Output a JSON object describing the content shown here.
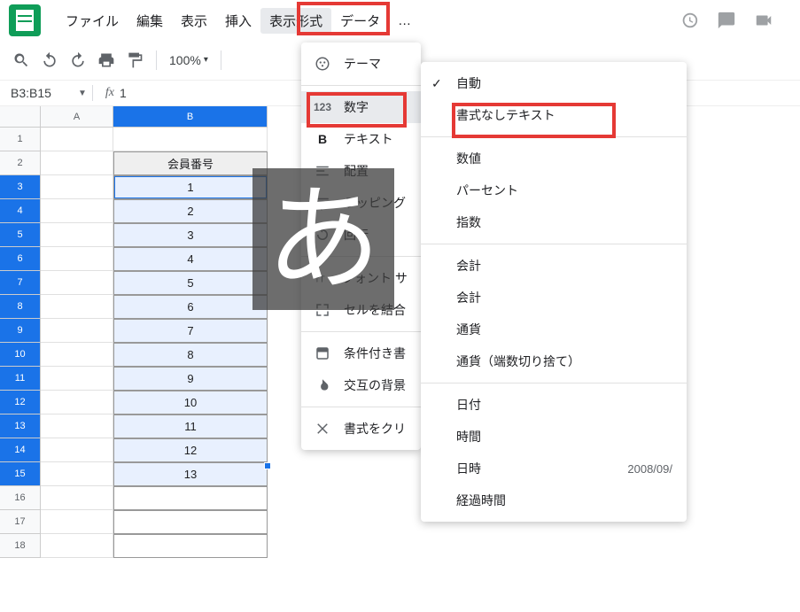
{
  "menu": {
    "file": "ファイル",
    "edit": "編集",
    "view": "表示",
    "insert": "挿入",
    "format": "表示形式",
    "data": "データ",
    "more": "…"
  },
  "toolbar": {
    "zoom": "100%"
  },
  "namebox": {
    "ref": "B3:B15",
    "formula": "1"
  },
  "columns": {
    "A": "A",
    "B": "B"
  },
  "header_b2": "会員番号",
  "rows_b": [
    "1",
    "2",
    "3",
    "4",
    "5",
    "6",
    "7",
    "8",
    "9",
    "10",
    "11",
    "12",
    "13"
  ],
  "row_labels": [
    "1",
    "2",
    "3",
    "4",
    "5",
    "6",
    "7",
    "8",
    "9",
    "10",
    "11",
    "12",
    "13",
    "14",
    "15",
    "16",
    "17",
    "18"
  ],
  "format_menu": {
    "theme": "テーマ",
    "number": "数字",
    "text": "テキスト",
    "align": "配置",
    "wrapping": "ラッピング",
    "rotation": "回転",
    "fontsize": "フォント サ",
    "merge": "セルを結合",
    "conditional": "条件付き書",
    "altcolors": "交互の背景",
    "clear": "書式をクリ"
  },
  "number_submenu": {
    "auto": "自動",
    "plain": "書式なしテキスト",
    "number": "数値",
    "percent": "パーセント",
    "scientific": "指数",
    "accounting": "会計",
    "financial": "会計",
    "currency": "通貨",
    "currency_rounded": "通貨（端数切り捨て）",
    "date": "日付",
    "time": "時間",
    "datetime": "日時",
    "datetime_sample": "2008/09/",
    "duration": "経過時間"
  },
  "ime_char": "あ",
  "chart_data": {
    "type": "table",
    "title": "会員番号",
    "columns": [
      "会員番号"
    ],
    "rows": [
      [
        1
      ],
      [
        2
      ],
      [
        3
      ],
      [
        4
      ],
      [
        5
      ],
      [
        6
      ],
      [
        7
      ],
      [
        8
      ],
      [
        9
      ],
      [
        10
      ],
      [
        11
      ],
      [
        12
      ],
      [
        13
      ]
    ]
  }
}
